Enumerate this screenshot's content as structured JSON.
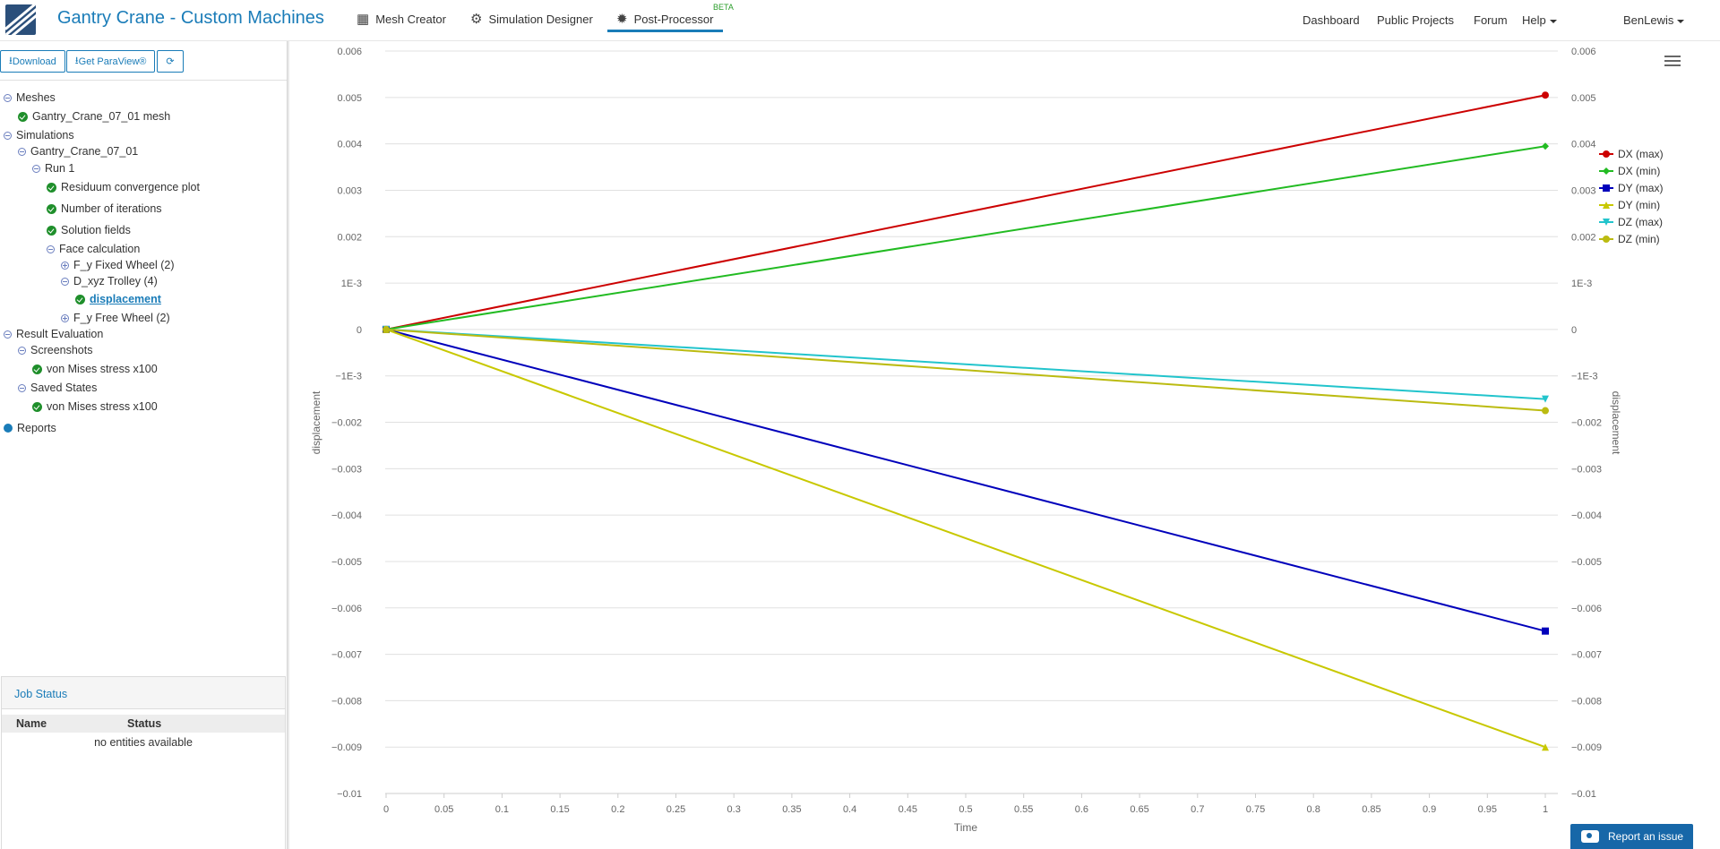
{
  "app": {
    "title": "Gantry Crane - Custom Machines",
    "nav_tabs": [
      {
        "label": "Mesh Creator",
        "icon": "grid-icon"
      },
      {
        "label": "Simulation Designer",
        "icon": "gears-icon"
      },
      {
        "label": "Post-Processor",
        "icon": "gear-icon",
        "badge": "BETA"
      }
    ],
    "nav_right": [
      "Dashboard",
      "Public Projects",
      "Forum",
      "Help"
    ],
    "user": "BenLewis",
    "accent": "#1a7cb8"
  },
  "toolbar": {
    "download_label": "Download",
    "paraview_label": "Get ParaView®",
    "refresh_icon": "refresh-icon"
  },
  "tree": {
    "meshes": "Meshes",
    "mesh_item": "Gantry_Crane_07_01 mesh",
    "simulations": "Simulations",
    "sim_item": "Gantry_Crane_07_01",
    "run": "Run 1",
    "residuum": "Residuum convergence plot",
    "iterations": "Number of iterations",
    "solution": "Solution fields",
    "face_calc": "Face calculation",
    "fixed_wheel": "F_y Fixed Wheel (2)",
    "trolley": "D_xyz Trolley (4)",
    "displacement": "displacement",
    "free_wheel": "F_y Free Wheel (2)",
    "result_eval": "Result Evaluation",
    "screenshots": "Screenshots",
    "screenshot_item": "von Mises stress x100",
    "saved_states": "Saved States",
    "state_item": "von Mises stress x100",
    "reports": "Reports"
  },
  "job_status": {
    "title": "Job Status",
    "col_name": "Name",
    "col_status": "Status",
    "empty": "no entities available"
  },
  "report_button": "Report an issue",
  "chart_data": {
    "type": "line",
    "title": "",
    "xlabel": "Time",
    "ylabel": "displacement",
    "ylabel_right": "displacement",
    "xlim": [
      0,
      1
    ],
    "ylim": [
      -0.01,
      0.006
    ],
    "x_ticks": [
      "0",
      "0.05",
      "0.1",
      "0.15",
      "0.2",
      "0.25",
      "0.3",
      "0.35",
      "0.4",
      "0.45",
      "0.5",
      "0.55",
      "0.6",
      "0.65",
      "0.7",
      "0.75",
      "0.8",
      "0.85",
      "0.9",
      "0.95",
      "1"
    ],
    "y_tick_values": [
      0.006,
      0.005,
      0.004,
      0.003,
      0.002,
      0.001,
      0,
      -0.001,
      -0.002,
      -0.003,
      -0.004,
      -0.005,
      -0.006,
      -0.007,
      -0.008,
      -0.009,
      -0.01
    ],
    "y_tick_labels": [
      "0.006",
      "0.005",
      "0.004",
      "0.003",
      "0.002",
      "1E-3",
      "0",
      "−1E-3",
      "−0.002",
      "−0.003",
      "−0.004",
      "−0.005",
      "−0.006",
      "−0.007",
      "−0.008",
      "−0.009",
      "−0.01"
    ],
    "grid": true,
    "legend_position": "right",
    "series": [
      {
        "name": "DX (max)",
        "color": "#cc0000",
        "marker": "circle",
        "x": [
          0,
          1
        ],
        "y": [
          0,
          0.00505
        ]
      },
      {
        "name": "DX (min)",
        "color": "#22bb22",
        "marker": "diamond",
        "x": [
          0,
          1
        ],
        "y": [
          0,
          0.00395
        ]
      },
      {
        "name": "DY (max)",
        "color": "#0000bb",
        "marker": "square",
        "x": [
          0,
          1
        ],
        "y": [
          0,
          -0.0065
        ]
      },
      {
        "name": "DY (min)",
        "color": "#c8c800",
        "marker": "triangle",
        "x": [
          0,
          1
        ],
        "y": [
          0,
          -0.009
        ]
      },
      {
        "name": "DZ (max)",
        "color": "#22c4cc",
        "marker": "triangle-down",
        "x": [
          0,
          1
        ],
        "y": [
          0,
          -0.0015
        ]
      },
      {
        "name": "DZ (min)",
        "color": "#bbbb11",
        "marker": "circle",
        "x": [
          0,
          1
        ],
        "y": [
          0,
          -0.00175
        ]
      }
    ]
  }
}
